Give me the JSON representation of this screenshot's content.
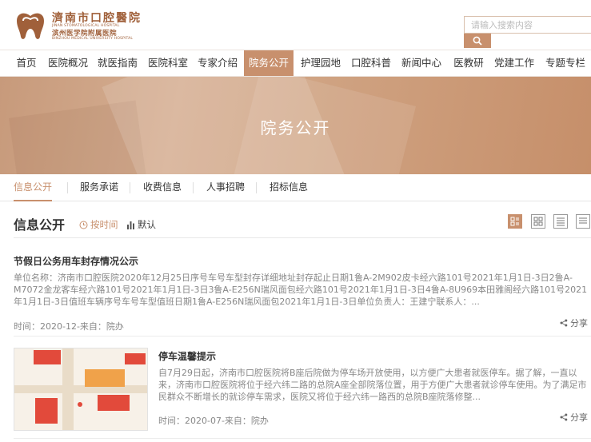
{
  "header": {
    "logo_cn": "濟南市口腔醫院",
    "logo_en_1": "JINAN STOMATOLOGICAL HOSPITAL",
    "logo_cn_2": "滨州医学院附属医院",
    "logo_en_2": "BINZHOU MEDICAL UNIVERSITY HOSPITAL",
    "search_placeholder": "请输入搜索内容",
    "search_icon": "search-icon"
  },
  "nav": {
    "items": [
      "首页",
      "医院概况",
      "就医指南",
      "医院科室",
      "专家介绍",
      "院务公开",
      "护理园地",
      "口腔科普",
      "新闻中心",
      "医教研",
      "党建工作",
      "专题专栏"
    ],
    "active_index": 5
  },
  "banner": {
    "title": "院务公开"
  },
  "subtabs": {
    "items": [
      "信息公开",
      "服务承诺",
      "收费信息",
      "人事招聘",
      "招标信息"
    ],
    "active_index": 0
  },
  "section": {
    "title": "信息公开",
    "sort_time": "按时间",
    "sort_default": "默认"
  },
  "items": [
    {
      "title": "节假日公务用车封存情况公示",
      "desc": "单位名称：济南市口腔医院2020年12月25日序号车号车型封存详细地址封存起止日期1鲁A-2M902皮卡经六路101号2021年1月1日-3日2鲁A-M7072金龙客车经六路101号2021年1月1日-3日3鲁A-E256N瑞风面包经六路101号2021年1月1日-3日4鲁A-8U969本田雅阁经六路101号2021年1月1日-3日值班车辆序号车号车型值班日期1鲁A-E256N瑞风面包2021年1月1日-3日单位负责人：王建宁联系人：...",
      "meta": "时间：2020-12-来自：院办",
      "share": "分享"
    },
    {
      "title": "停车温馨提示",
      "desc": "自7月29日起，济南市口腔医院将B座后院做为停车场开放使用，以方便广大患者就医停车。据了解，一直以来，济南市口腔医院将位于经六纬二路的总院A座全部院落位置，用于方便广大患者就诊停车使用。为了满足市民群众不断增长的就诊停车需求，医院又将位于经六纬一路西的总院B座院落修整...",
      "meta": "时间：2020-07-来自：院办",
      "share": "分享"
    }
  ],
  "colors": {
    "accent": "#c8906d",
    "logo": "#a0603a"
  }
}
